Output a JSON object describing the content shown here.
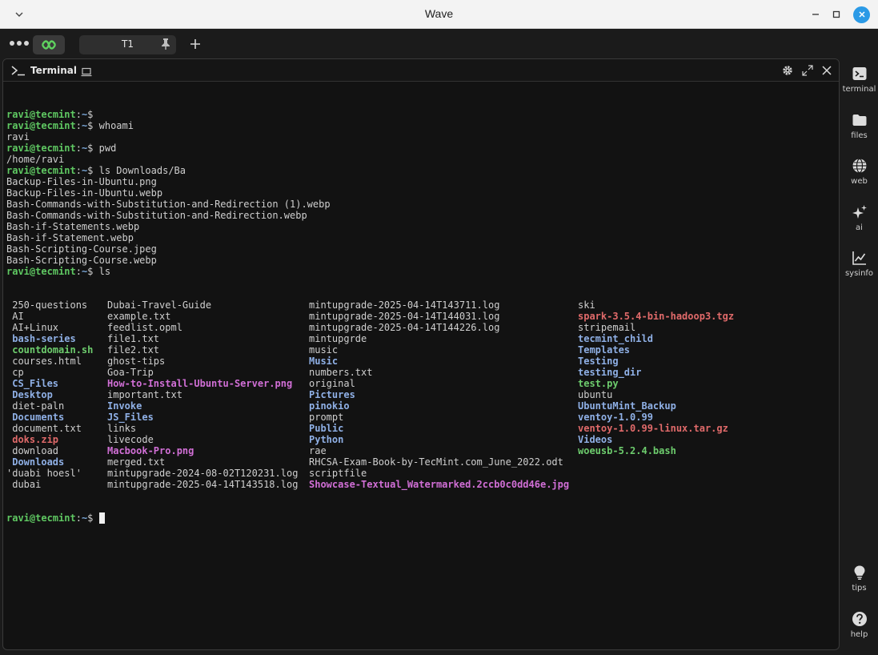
{
  "window": {
    "title": "Wave"
  },
  "tabs": [
    {
      "label": "T1"
    }
  ],
  "block": {
    "title": "Terminal"
  },
  "terminal": {
    "user": "ravi@tecmint",
    "path": "~",
    "lines": [
      {
        "type": "prompt",
        "cmd": ""
      },
      {
        "type": "prompt",
        "cmd": "whoami"
      },
      {
        "type": "out",
        "text": "ravi"
      },
      {
        "type": "prompt",
        "cmd": "pwd"
      },
      {
        "type": "out",
        "text": "/home/ravi"
      },
      {
        "type": "prompt",
        "cmd": "ls Downloads/Ba"
      },
      {
        "type": "out",
        "text": "Backup-Files-in-Ubuntu.png"
      },
      {
        "type": "out",
        "text": "Backup-Files-in-Ubuntu.webp"
      },
      {
        "type": "out",
        "text": "Bash-Commands-with-Substitution-and-Redirection (1).webp"
      },
      {
        "type": "out",
        "text": "Bash-Commands-with-Substitution-and-Redirection.webp"
      },
      {
        "type": "out",
        "text": "Bash-if-Statements.webp"
      },
      {
        "type": "out",
        "text": "Bash-if-Statement.webp"
      },
      {
        "type": "out",
        "text": "Bash-Scripting-Course.jpeg"
      },
      {
        "type": "out",
        "text": "Bash-Scripting-Course.webp"
      },
      {
        "type": "prompt",
        "cmd": "ls"
      }
    ],
    "ls_columns": [
      [
        {
          "name": " 250-questions",
          "kind": "file"
        },
        {
          "name": " AI",
          "kind": "file"
        },
        {
          "name": " AI+Linux",
          "kind": "file"
        },
        {
          "name": " bash-series",
          "kind": "dir"
        },
        {
          "name": " countdomain.sh",
          "kind": "exe"
        },
        {
          "name": " courses.html",
          "kind": "file"
        },
        {
          "name": " cp",
          "kind": "file"
        },
        {
          "name": " CS_Files",
          "kind": "dir"
        },
        {
          "name": " Desktop",
          "kind": "dir"
        },
        {
          "name": " diet-paln",
          "kind": "file"
        },
        {
          "name": " Documents",
          "kind": "dir"
        },
        {
          "name": " document.txt",
          "kind": "file"
        },
        {
          "name": " doks.zip",
          "kind": "arc"
        },
        {
          "name": " download",
          "kind": "file"
        },
        {
          "name": " Downloads",
          "kind": "dir"
        },
        {
          "name": "'duabi hoesl'",
          "kind": "file"
        },
        {
          "name": " dubai",
          "kind": "file"
        }
      ],
      [
        {
          "name": "Dubai-Travel-Guide",
          "kind": "file"
        },
        {
          "name": "example.txt",
          "kind": "file"
        },
        {
          "name": "feedlist.opml",
          "kind": "file"
        },
        {
          "name": "file1.txt",
          "kind": "file"
        },
        {
          "name": "file2.txt",
          "kind": "file"
        },
        {
          "name": "ghost-tips",
          "kind": "file"
        },
        {
          "name": "Goa-Trip",
          "kind": "file"
        },
        {
          "name": "How-to-Install-Ubuntu-Server.png",
          "kind": "img"
        },
        {
          "name": "important.txt",
          "kind": "file"
        },
        {
          "name": "Invoke",
          "kind": "dir"
        },
        {
          "name": "JS_Files",
          "kind": "dir"
        },
        {
          "name": "links",
          "kind": "file"
        },
        {
          "name": "livecode",
          "kind": "file"
        },
        {
          "name": "Macbook-Pro.png",
          "kind": "img"
        },
        {
          "name": "merged.txt",
          "kind": "file"
        },
        {
          "name": "mintupgrade-2024-08-02T120231.log",
          "kind": "file"
        },
        {
          "name": "mintupgrade-2025-04-14T143518.log",
          "kind": "file"
        }
      ],
      [
        {
          "name": "mintupgrade-2025-04-14T143711.log",
          "kind": "file"
        },
        {
          "name": "mintupgrade-2025-04-14T144031.log",
          "kind": "file"
        },
        {
          "name": "mintupgrade-2025-04-14T144226.log",
          "kind": "file"
        },
        {
          "name": "mintupgrde",
          "kind": "file"
        },
        {
          "name": "music",
          "kind": "file"
        },
        {
          "name": "Music",
          "kind": "dir"
        },
        {
          "name": "numbers.txt",
          "kind": "file"
        },
        {
          "name": "original",
          "kind": "file"
        },
        {
          "name": "Pictures",
          "kind": "dir"
        },
        {
          "name": "pinokio",
          "kind": "dir"
        },
        {
          "name": "prompt",
          "kind": "file"
        },
        {
          "name": "Public",
          "kind": "dir"
        },
        {
          "name": "Python",
          "kind": "dir"
        },
        {
          "name": "rae",
          "kind": "file"
        },
        {
          "name": "RHCSA-Exam-Book-by-TecMint.com_June_2022.odt",
          "kind": "file"
        },
        {
          "name": "scriptfile",
          "kind": "file"
        },
        {
          "name": "Showcase-Textual_Watermarked.2ccb0c0dd46e.jpg",
          "kind": "img"
        }
      ],
      [
        {
          "name": "ski",
          "kind": "file"
        },
        {
          "name": "spark-3.5.4-bin-hadoop3.tgz",
          "kind": "arc"
        },
        {
          "name": "stripemail",
          "kind": "file"
        },
        {
          "name": "tecmint_child",
          "kind": "dir"
        },
        {
          "name": "Templates",
          "kind": "dir"
        },
        {
          "name": "Testing",
          "kind": "dir"
        },
        {
          "name": "testing_dir",
          "kind": "dir"
        },
        {
          "name": "test.py",
          "kind": "exe"
        },
        {
          "name": "ubuntu",
          "kind": "file"
        },
        {
          "name": "UbuntuMint_Backup",
          "kind": "dir"
        },
        {
          "name": "ventoy-1.0.99",
          "kind": "dir"
        },
        {
          "name": "ventoy-1.0.99-linux.tar.gz",
          "kind": "arc"
        },
        {
          "name": "Videos",
          "kind": "dir"
        },
        {
          "name": "woeusb-5.2.4.bash",
          "kind": "exe"
        }
      ]
    ]
  },
  "sidebar": {
    "top": [
      {
        "label": "terminal",
        "icon": "terminal-icon"
      },
      {
        "label": "files",
        "icon": "folder-icon"
      },
      {
        "label": "web",
        "icon": "globe-icon"
      },
      {
        "label": "ai",
        "icon": "sparkle-icon"
      },
      {
        "label": "sysinfo",
        "icon": "chart-icon"
      }
    ],
    "bottom": [
      {
        "label": "tips",
        "icon": "lightbulb-icon"
      },
      {
        "label": "help",
        "icon": "help-icon"
      }
    ]
  },
  "colors": {
    "prompt_user": "#5fc862",
    "prompt_path": "#7aa7d8",
    "dir": "#8fb0e6",
    "exe": "#6dcc6d",
    "archive": "#e06a6a",
    "image": "#d16fd6",
    "accent": "#2b9ae6"
  }
}
